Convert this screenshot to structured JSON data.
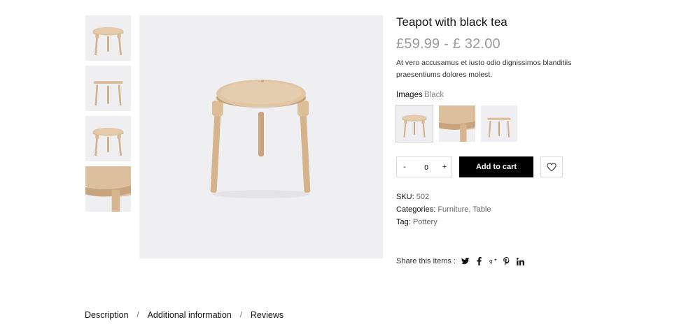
{
  "product": {
    "title": "Teapot with black tea",
    "price": "£59.99 - £ 32.00",
    "description": "At vero accusamus et iusto odio dignissimos blanditiis praesentiums dolores molest."
  },
  "gallery": {
    "thumbnails": [
      "stool-front-icon",
      "stool-side-icon",
      "stool-angle-icon",
      "stool-seat-closeup-icon"
    ],
    "main_image": "stool-main-image"
  },
  "options": {
    "label": "Images",
    "selected_value": "Black",
    "swatches": [
      "stool-swatch-1",
      "stool-swatch-2",
      "stool-swatch-3"
    ]
  },
  "cart": {
    "minus": "-",
    "quantity": "0",
    "plus": "+",
    "add_to_cart": "Add to cart",
    "wishlist_icon": "heart-icon"
  },
  "meta": {
    "sku_label": "SKU:",
    "sku_value": "502",
    "categories_label": "Categories:",
    "category_1": "Furniture",
    "category_sep": ",",
    "category_2": "Table",
    "tag_label": "Tag:",
    "tag_value": "Pottery"
  },
  "share": {
    "label": "Share this items :",
    "icons": [
      "twitter-icon",
      "facebook-icon",
      "google-plus-icon",
      "pinterest-icon",
      "linkedin-icon"
    ]
  },
  "tabs": {
    "description": "Description",
    "additional": "Additional information",
    "reviews": "Reviews",
    "separator": "/"
  },
  "colors": {
    "image_bg": "#efeff1",
    "wood": "#d7b995",
    "button": "#000000",
    "price": "#9a9a9a"
  }
}
